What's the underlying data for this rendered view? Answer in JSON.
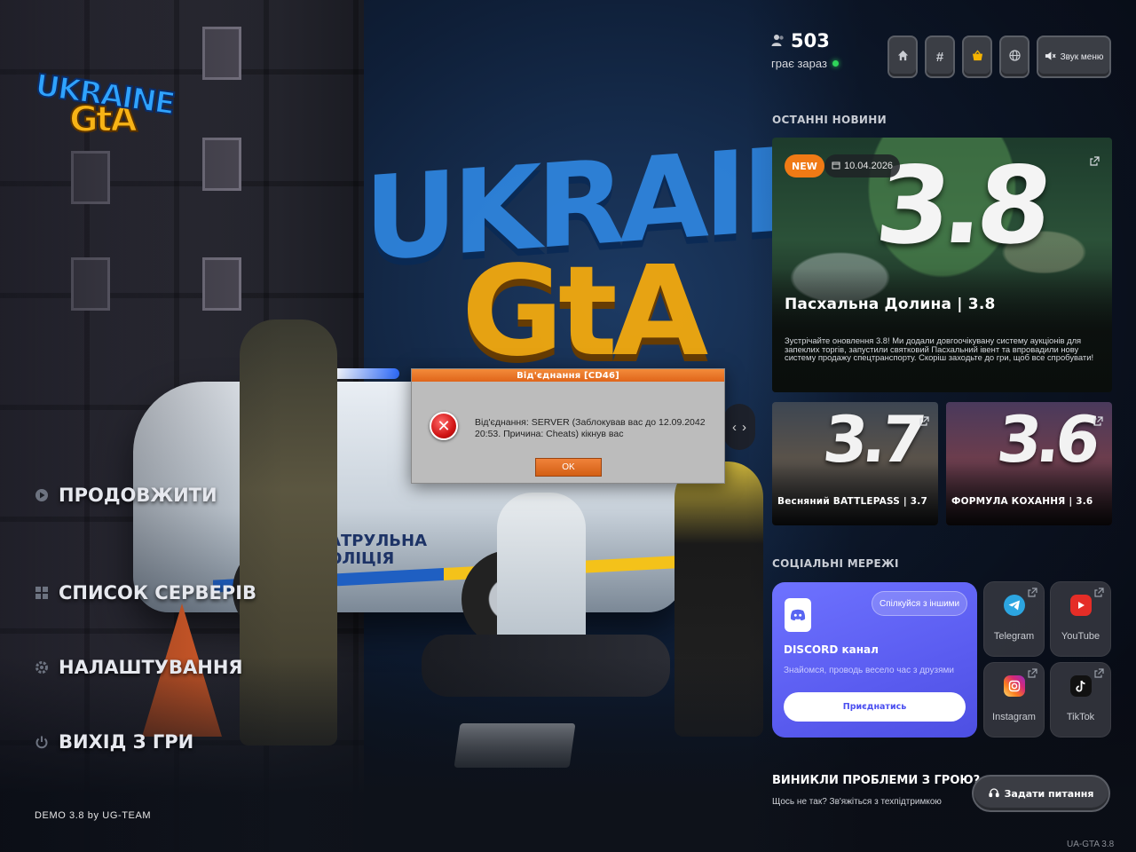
{
  "logo": {
    "line1": "UKRAINE",
    "line2": "GtA"
  },
  "scene": {
    "car_text": "ПАТРУЛЬНА\nПОЛІЦІЯ"
  },
  "menu": {
    "items": [
      {
        "label": "ПРОДОВЖИТИ",
        "icon": "play-icon"
      },
      {
        "label": "СПИСОК СЕРВЕРІВ",
        "icon": "grid-icon"
      },
      {
        "label": "НАЛАШТУВАННЯ",
        "icon": "gear-icon"
      },
      {
        "label": "ВИХІД З ГРИ",
        "icon": "power-icon"
      }
    ]
  },
  "footer": {
    "demo": "DEMO 3.8 by UG-TEAM",
    "version": "UA-GTA 3.8"
  },
  "online": {
    "count": "503",
    "label": "грає зараз",
    "status_color": "#2fd55a"
  },
  "topbar": {
    "sound_label": "Звук меню",
    "active": "shop-icon"
  },
  "news": {
    "section_title": "ОСТАННІ НОВИНИ",
    "main": {
      "badge": "NEW",
      "date": "10.04.2026",
      "big_number": "3.8",
      "title": "Пасхальна Долина | 3.8",
      "description": "Зустрічайте оновлення 3.8! Ми додали довгоочікувану систему аукціонів для запеклих торгів, запустили святковий Пасхальний івент та впровадили нову систему продажу спецтранспорту. Скоріш заходьте до гри, щоб все спробувати!"
    },
    "cards": [
      {
        "number": "3.7",
        "title": "Весняний BATTLEPASS | 3.7"
      },
      {
        "number": "3.6",
        "title": "ФОРМУЛА КОХАННЯ | 3.6"
      }
    ]
  },
  "social": {
    "section_title": "СОЦІАЛЬНІ МЕРЕЖІ",
    "discord": {
      "pill": "Спілкуйся з іншими",
      "title": "DISCORD канал",
      "subtitle": "Знайомся, проводь весело час з друзями",
      "join": "Приєднатись",
      "color": "#5a5cf0"
    },
    "links": [
      {
        "label": "Telegram",
        "icon": "telegram-icon",
        "color": "#2ca5e0"
      },
      {
        "label": "YouTube",
        "icon": "youtube-icon",
        "color": "#e52d27"
      },
      {
        "label": "Instagram",
        "icon": "instagram-icon",
        "color": "#d6249f"
      },
      {
        "label": "TikTok",
        "icon": "tiktok-icon",
        "color": "#111111"
      }
    ]
  },
  "help": {
    "title": "ВИНИКЛИ ПРОБЛЕМИ З ГРОЮ?",
    "subtitle": "Щось не так? Зв'яжіться з техпідтримкою",
    "button": "Задати питання"
  },
  "dialog": {
    "title": "Від'єднання [CD46]",
    "message": "Від'єднання: SERVER (Заблокував вас до 12.09.2042 20:53. Причина: Cheats) кікнув вас",
    "ok": "OK"
  }
}
